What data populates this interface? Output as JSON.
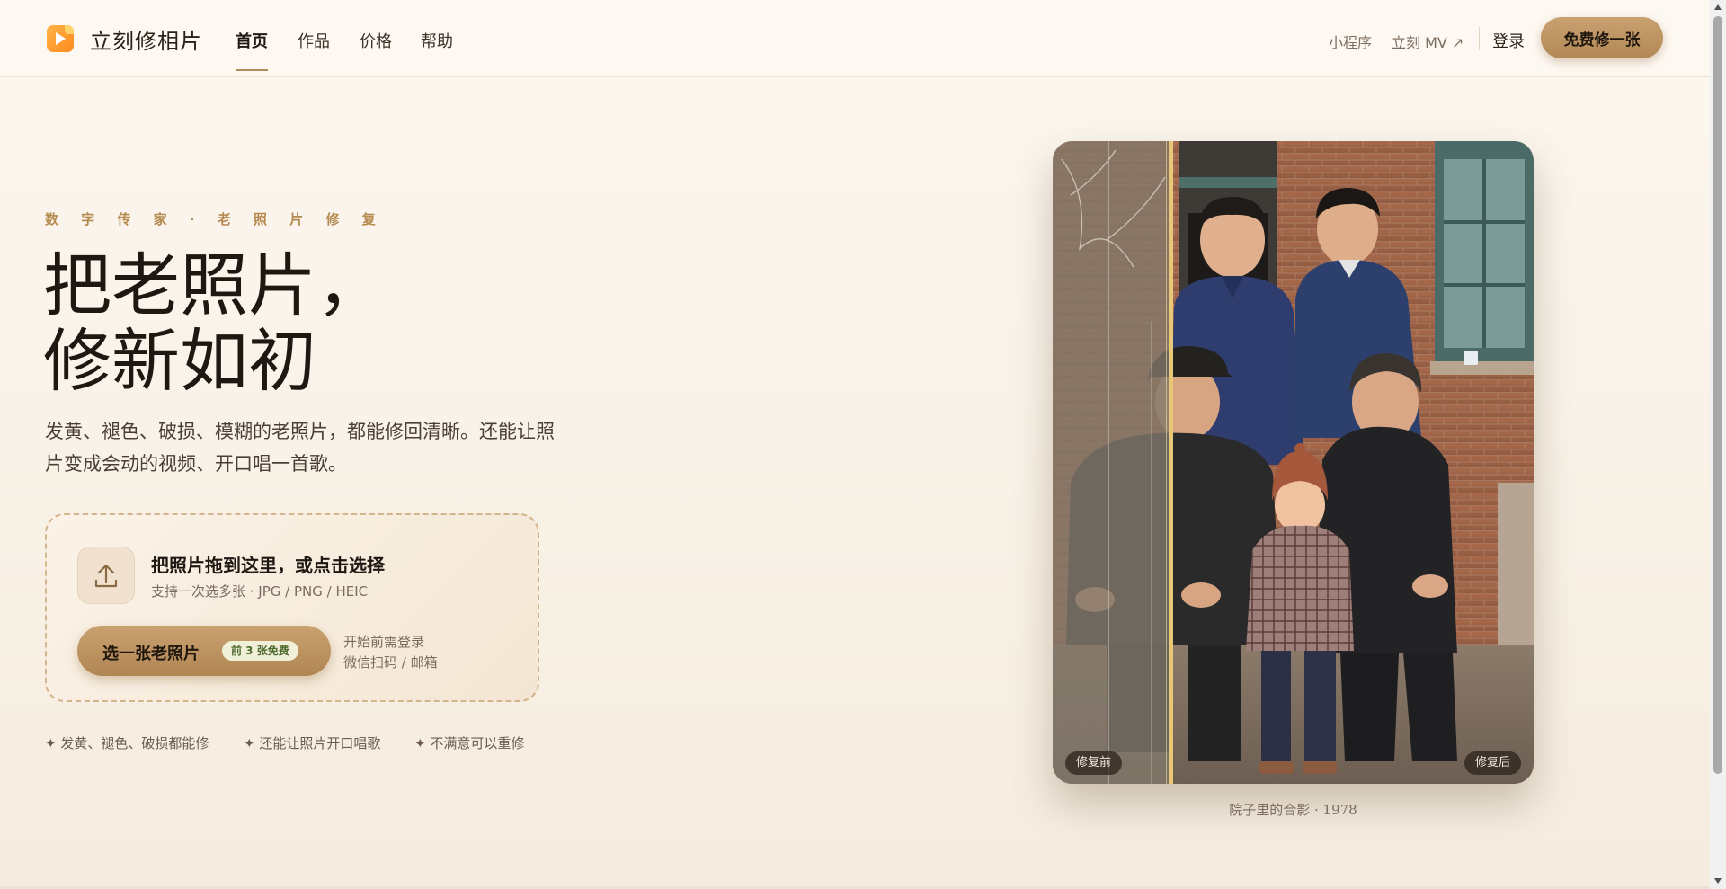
{
  "brand": {
    "name": "立刻修相片"
  },
  "nav": {
    "items": [
      {
        "label": "首页",
        "active": true
      },
      {
        "label": "作品"
      },
      {
        "label": "价格"
      },
      {
        "label": "帮助"
      }
    ]
  },
  "header": {
    "mini_program": "小程序",
    "mv_link": "立刻 MV ↗",
    "login": "登录",
    "cta": "免费修一张"
  },
  "hero": {
    "eyebrow": "数 字 传 家 · 老 照 片 修 复",
    "headline_line1": "把老照片，",
    "headline_line2": "修新如初",
    "description": "发黄、褪色、破损、模糊的老照片，都能修回清晰。还能让照片变成会动的视频、开口唱一首歌。"
  },
  "upload": {
    "title": "把照片拖到这里，或点击选择",
    "subtitle": "支持一次选多张 · JPG / PNG / HEIC",
    "button_label": "选一张老照片",
    "badge": "前 3 张免费",
    "note_line1": "开始前需登录",
    "note_line2": "微信扫码 / 邮箱",
    "icon": "upload-icon"
  },
  "features": [
    "✦ 发黄、褪色、破损都能修",
    "✦ 还能让照片开口唱歌",
    "✦ 不满意可以重修"
  ],
  "compare": {
    "before_label": "修复前",
    "after_label": "修复后",
    "caption": "院子里的合影 · 1978",
    "divider_color": "#e8c777"
  },
  "colors": {
    "accent": "#b58a4e",
    "cta_bg": "#c09565",
    "background": "#fcf7f0"
  }
}
